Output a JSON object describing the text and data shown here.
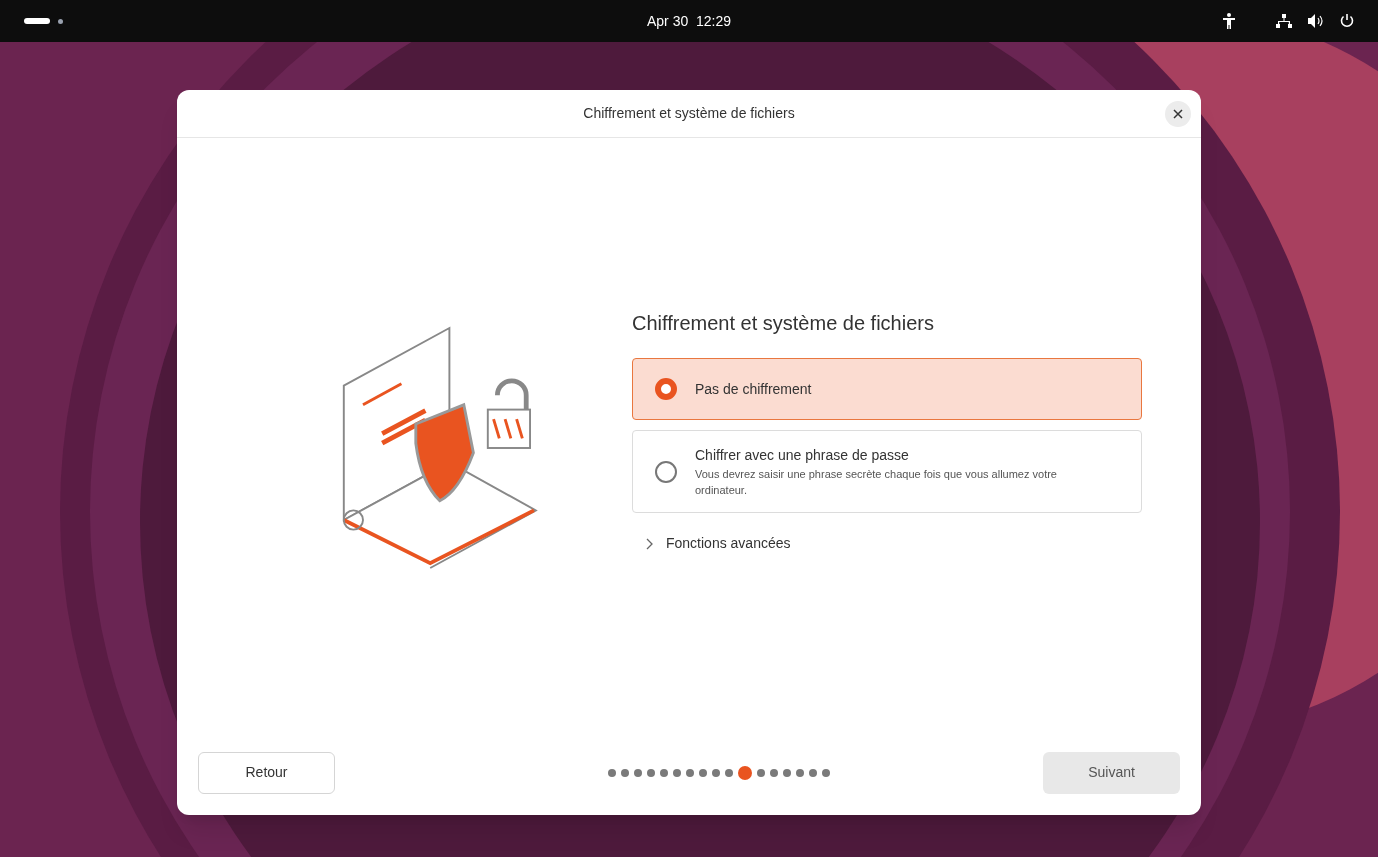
{
  "top_bar": {
    "clock": "Apr 30  12:29"
  },
  "dialog": {
    "title": "Chiffrement et système de fichiers"
  },
  "heading": "Chiffrement et système de fichiers",
  "options": [
    {
      "title": "Pas de chiffrement",
      "selected": true
    },
    {
      "title": "Chiffrer avec une phrase de passe",
      "description": "Vous devrez saisir une phrase secrète chaque fois que vous allumez votre ordinateur.",
      "selected": false
    }
  ],
  "advanced": {
    "label": "Fonctions avancées",
    "expanded": false
  },
  "back_button": {
    "label": "Retour",
    "disabled": false
  },
  "next_button": {
    "label": "Suivant",
    "disabled": true
  },
  "steps": [
    {
      "selected": false
    },
    {
      "selected": false
    },
    {
      "selected": false
    },
    {
      "selected": false
    },
    {
      "selected": false
    },
    {
      "selected": false
    },
    {
      "selected": false
    },
    {
      "selected": false
    },
    {
      "selected": false
    },
    {
      "selected": false
    },
    {
      "selected": true
    },
    {
      "selected": false
    },
    {
      "selected": false
    },
    {
      "selected": false
    },
    {
      "selected": false
    },
    {
      "selected": false
    },
    {
      "selected": false
    }
  ]
}
